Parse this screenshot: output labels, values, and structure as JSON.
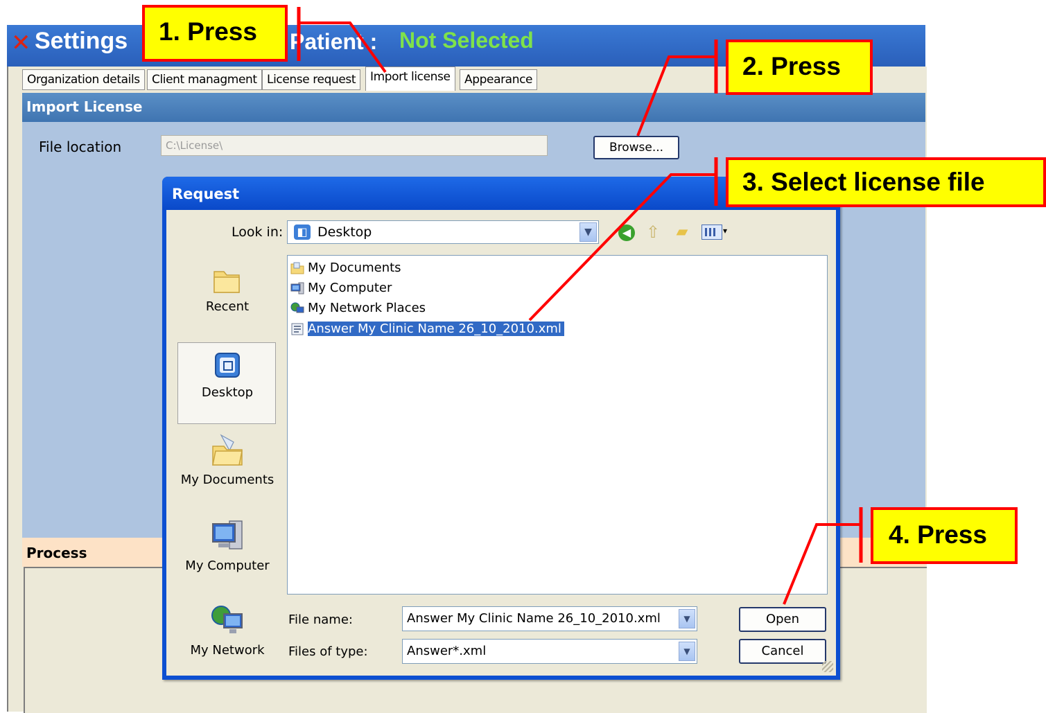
{
  "window": {
    "title": "Settings",
    "patient_label": "Patient :",
    "patient_value": "Not Selected"
  },
  "tabs": [
    {
      "label": "Organization details",
      "active": false
    },
    {
      "label": "Client managment",
      "active": false
    },
    {
      "label": "License request",
      "active": false
    },
    {
      "label": "Import license",
      "active": true
    },
    {
      "label": "Appearance",
      "active": false
    }
  ],
  "import_section": {
    "header": "Import License",
    "file_location_label": "File location",
    "file_location_value": "C:\\License\\",
    "browse_label": "Browse..."
  },
  "process_section": {
    "header": "Process"
  },
  "dialog": {
    "title": "Request",
    "look_in_label": "Look in:",
    "look_in_value": "Desktop",
    "places": [
      {
        "label": "Recent",
        "icon": "recent-folder-icon"
      },
      {
        "label": "Desktop",
        "icon": "desktop-icon",
        "selected": true
      },
      {
        "label": "My Documents",
        "icon": "my-documents-icon"
      },
      {
        "label": "My Computer",
        "icon": "my-computer-icon"
      },
      {
        "label": "My Network",
        "icon": "my-network-icon"
      }
    ],
    "files": [
      {
        "name": "My Documents",
        "icon": "my-documents-icon"
      },
      {
        "name": "My Computer",
        "icon": "my-computer-icon"
      },
      {
        "name": "My Network Places",
        "icon": "network-places-icon"
      },
      {
        "name": "Answer My Clinic Name 26_10_2010.xml",
        "icon": "xml-file-icon",
        "selected": true
      }
    ],
    "file_name_label": "File name:",
    "file_name_value": "Answer My Clinic Name 26_10_2010.xml",
    "file_type_label": "Files of type:",
    "file_type_value": "Answer*.xml",
    "open_label": "Open",
    "cancel_label": "Cancel"
  },
  "callouts": {
    "step1": "1. Press",
    "step2": "2. Press",
    "step3": "3. Select license file",
    "step4": "4. Press"
  },
  "colors": {
    "callout_fill": "#ffff00",
    "callout_border": "#ff0000",
    "patient_value": "#7fe24a",
    "selection": "#316ac5"
  }
}
